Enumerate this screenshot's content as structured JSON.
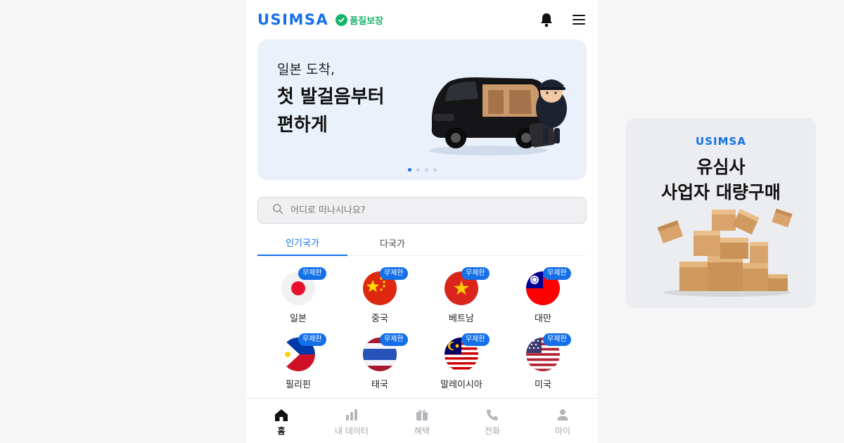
{
  "header": {
    "logo": "USIMSA",
    "quality_label": "품질보장",
    "icons": {
      "notifications": "bell-icon",
      "menu": "hamburger-icon"
    }
  },
  "banner": {
    "subtitle": "일본 도착,",
    "title_line1": "첫 발걸음부터",
    "title_line2": "편하게",
    "slide_count": 4,
    "active_slide": 1
  },
  "search": {
    "placeholder": "어디로 떠나시나요?",
    "value": "",
    "icon": "search-icon"
  },
  "tabs": [
    {
      "label": "인기국가",
      "active": true
    },
    {
      "label": "다국가",
      "active": false
    }
  ],
  "countries": [
    {
      "name": "일본",
      "badge": "무제한"
    },
    {
      "name": "중국",
      "badge": "무제한"
    },
    {
      "name": "베트남",
      "badge": "무제한"
    },
    {
      "name": "대만",
      "badge": "무제한"
    },
    {
      "name": "필리핀",
      "badge": "무제한"
    },
    {
      "name": "태국",
      "badge": "무제한"
    },
    {
      "name": "말레이시아",
      "badge": "무제한"
    },
    {
      "name": "미국",
      "badge": "무제한"
    }
  ],
  "bottom_nav": [
    {
      "label": "홈",
      "icon": "home-icon",
      "active": true
    },
    {
      "label": "내 데이터",
      "icon": "bar-chart-icon",
      "active": false
    },
    {
      "label": "혜택",
      "icon": "gift-icon",
      "active": false
    },
    {
      "label": "전화",
      "icon": "phone-icon",
      "active": false
    },
    {
      "label": "마이",
      "icon": "person-icon",
      "active": false
    }
  ],
  "side_ad": {
    "logo": "USIMSA",
    "title_line1": "유심사",
    "title_line2": "사업자 대량구매"
  },
  "colors": {
    "brand": "#1570e8",
    "quality_green": "#19b26b",
    "banner_bg": "#eaf1fb",
    "page_bg": "#f6f6f7"
  }
}
